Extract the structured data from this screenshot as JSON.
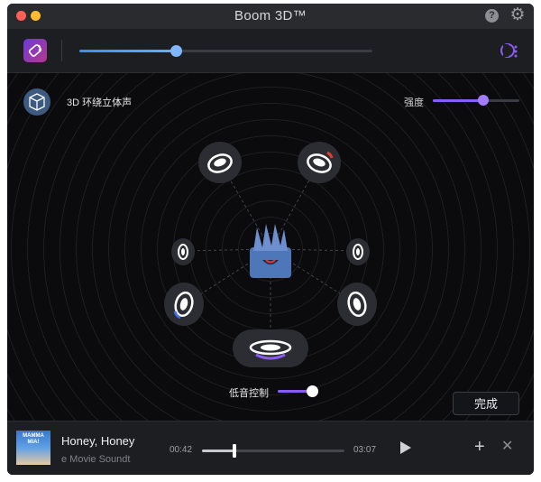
{
  "window": {
    "title": "Boom 3D™"
  },
  "volume": {
    "level": 0.33
  },
  "surround": {
    "feature_label": "3D 环绕立体声",
    "intensity_label": "强度",
    "intensity_level": 0.58,
    "bass_label": "低音控制",
    "bass_level": 0.9,
    "done_label": "完成"
  },
  "player": {
    "track_title": "Honey, Honey",
    "album_name": "e Movie Soundt",
    "art_text": "MAMMA MIA!",
    "time_elapsed": "00:42",
    "time_total": "03:07",
    "progress": 0.23
  },
  "colors": {
    "accent": "#8a5cf6",
    "volume": "#3a8ef0",
    "background": "#0b0b0e"
  }
}
